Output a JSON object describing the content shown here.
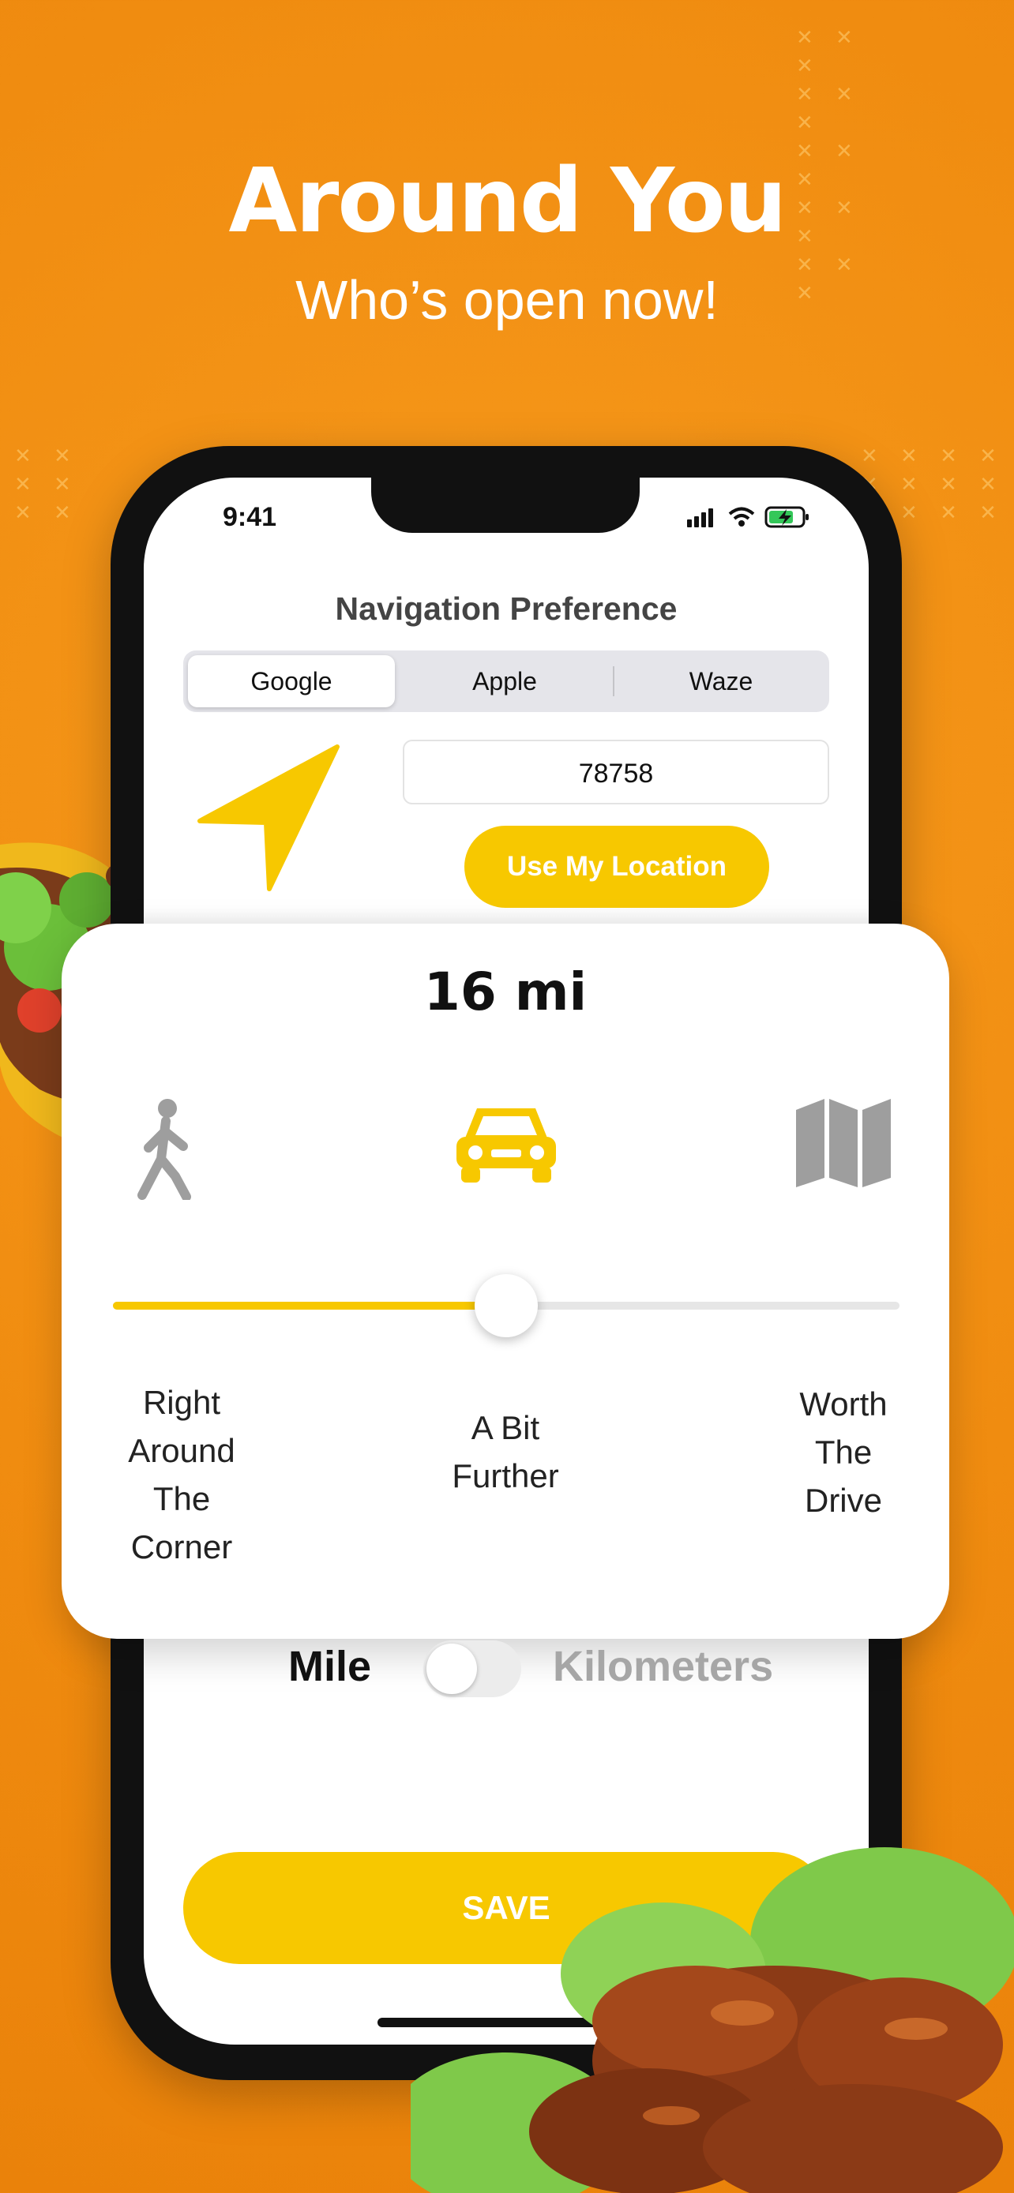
{
  "promo": {
    "headline": "Around You",
    "subheadline": "Who’s open now!"
  },
  "status_bar": {
    "time": "9:41"
  },
  "navigation": {
    "title": "Navigation Preference",
    "options": [
      "Google",
      "Apple",
      "Waze"
    ],
    "selected": "Google"
  },
  "location": {
    "zip_value": "78758",
    "use_location_label": "Use My Location"
  },
  "distance": {
    "value_label": "16 mi",
    "slider_fraction": 0.5,
    "labels": {
      "near": [
        "Right",
        "Around",
        "The",
        "Corner"
      ],
      "mid": [
        "A Bit",
        "Further"
      ],
      "far": [
        "Worth",
        "The",
        "Drive"
      ]
    },
    "icons": [
      "walking-icon",
      "car-icon",
      "map-icon"
    ]
  },
  "units": {
    "mile_label": "Mile",
    "km_label": "Kilometers",
    "kilometers_enabled": false
  },
  "actions": {
    "save_label": "SAVE"
  },
  "colors": {
    "background": "#f08c10",
    "accent": "#f7c800",
    "muted_icon": "#9e9e9e"
  }
}
